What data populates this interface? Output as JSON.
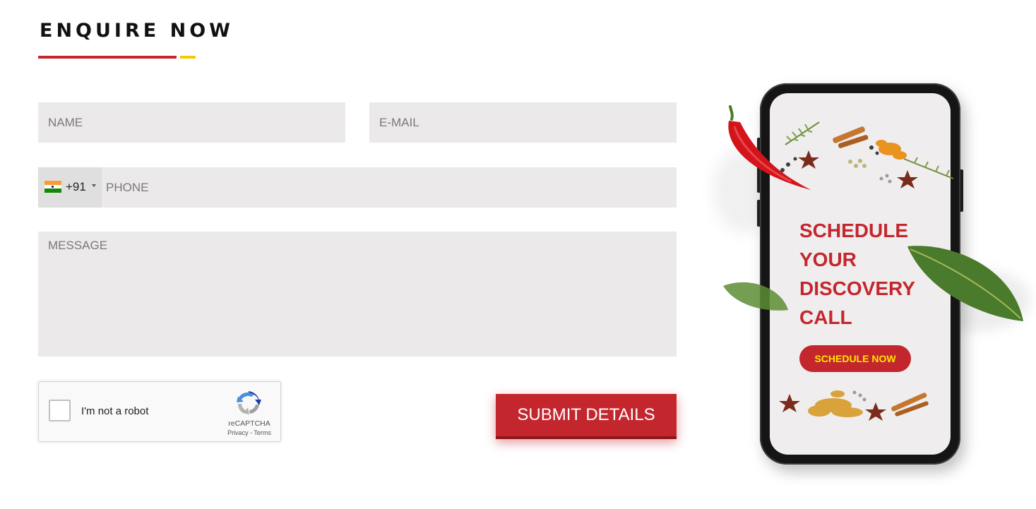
{
  "form": {
    "heading": "ENQUIRE NOW",
    "name_placeholder": "NAME",
    "email_placeholder": "E-MAIL",
    "phone": {
      "dial_code": "+91",
      "country_flag": "india-flag-icon",
      "placeholder": "PHONE"
    },
    "message_placeholder": "MESSAGE",
    "submit_label": "SUBMIT DETAILS"
  },
  "captcha": {
    "label": "I'm not a robot",
    "brand": "reCAPTCHA",
    "privacy": "Privacy",
    "separator": " - ",
    "terms": "Terms",
    "logo_icon": "recaptcha-logo-icon"
  },
  "promo": {
    "title_lines": [
      "SCHEDULE",
      "YOUR",
      "DISCOVERY",
      "CALL"
    ],
    "button_label": "SCHEDULE NOW",
    "decorations": [
      "red-chili-icon",
      "spices-icon",
      "bay-leaf-icon",
      "green-leaf-icon"
    ]
  },
  "colors": {
    "accent_red": "#c4262e",
    "accent_yellow": "#f6c800",
    "field_bg": "#ebe9ea",
    "promo_button_text": "#ffe500"
  }
}
